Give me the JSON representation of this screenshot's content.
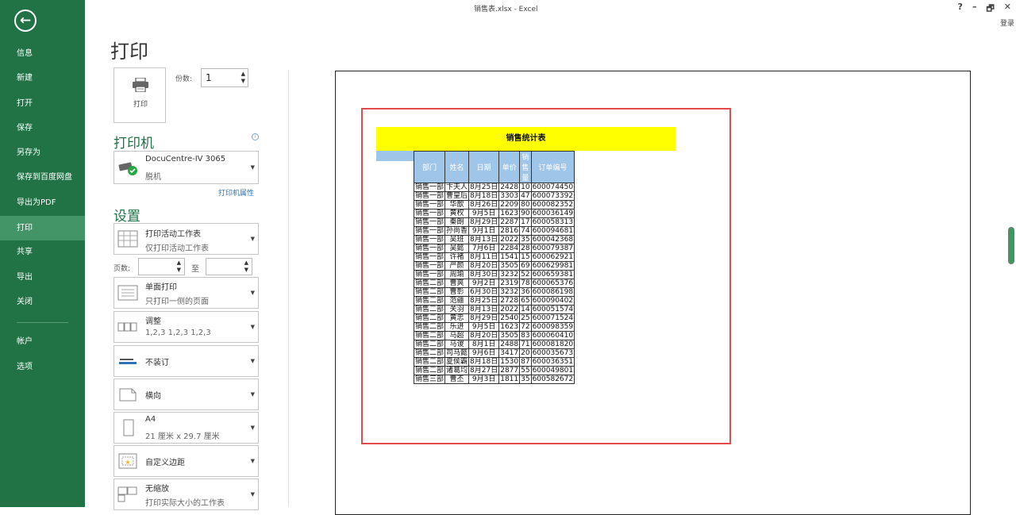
{
  "window": {
    "title": "销售表.xlsx - Excel",
    "help": "?",
    "minimize": "–",
    "restore": "🗗",
    "close": "✕",
    "login": "登录"
  },
  "nav": {
    "back": "←",
    "items": [
      "信息",
      "新建",
      "打开",
      "保存",
      "另存为",
      "保存到百度网盘",
      "导出为PDF",
      "打印",
      "共享",
      "导出",
      "关闭"
    ],
    "bottom_items": [
      "帐户",
      "选项"
    ],
    "active": "打印"
  },
  "print_panel": {
    "title": "打印",
    "print_button": "打印",
    "copies_label": "份数:",
    "copies_value": "1",
    "printer_heading": "打印机",
    "printer_name": "DocuCentre-IV 3065",
    "printer_status": "脱机",
    "printer_props": "打印机属性",
    "settings_heading": "设置",
    "pages_label": "页数:",
    "pages_to": "至",
    "settings": [
      {
        "line1": "打印活动工作表",
        "line2": "仅打印活动工作表"
      },
      {
        "line1": "单面打印",
        "line2": "只打印一侧的页面"
      },
      {
        "line1": "调整",
        "line2": "1,2,3    1,2,3    1,2,3"
      },
      {
        "line1": "不装订",
        "line2": ""
      },
      {
        "line1": "横向",
        "line2": ""
      },
      {
        "line1": "A4",
        "line2": "21 厘米 x 29.7 厘米"
      },
      {
        "line1": "自定义边距",
        "line2": ""
      },
      {
        "line1": "无缩放",
        "line2": "打印实际大小的工作表"
      }
    ]
  },
  "preview": {
    "sheet_title": "销售统计表",
    "headers": [
      "部门",
      "姓名",
      "日期",
      "单价",
      "销售量",
      "订单编号"
    ],
    "rows": [
      [
        "销售一部",
        "卞夫人",
        "8月25日",
        "2428",
        "10",
        "600074450"
      ],
      [
        "销售一部",
        "曹皇后",
        "8月18日",
        "3303",
        "47",
        "600073392"
      ],
      [
        "销售一部",
        "华歆",
        "8月26日",
        "2209",
        "80",
        "600082352"
      ],
      [
        "销售一部",
        "黄权",
        "9月5日",
        "1623",
        "90",
        "600036149"
      ],
      [
        "销售一部",
        "秦朗",
        "8月29日",
        "2287",
        "17",
        "600058313"
      ],
      [
        "销售一部",
        "孙尚香",
        "9月1日",
        "2816",
        "74",
        "600094681"
      ],
      [
        "销售一部",
        "吴班",
        "8月13日",
        "2022",
        "35",
        "600042368"
      ],
      [
        "销售一部",
        "吴懿",
        "7月6日",
        "2284",
        "28",
        "600079387"
      ],
      [
        "销售一部",
        "许褚",
        "8月11日",
        "1541",
        "15",
        "600062921"
      ],
      [
        "销售一部",
        "严颜",
        "8月20日",
        "3505",
        "69",
        "600629981"
      ],
      [
        "销售一部",
        "周瑜",
        "8月30日",
        "3232",
        "52",
        "600659381"
      ],
      [
        "销售二部",
        "曹爽",
        "9月2日",
        "2319",
        "78",
        "600065376"
      ],
      [
        "销售二部",
        "曹彰",
        "6月30日",
        "3232",
        "36",
        "600086198"
      ],
      [
        "销售二部",
        "范疆",
        "8月25日",
        "2728",
        "65",
        "600090402"
      ],
      [
        "销售二部",
        "关羽",
        "8月13日",
        "2022",
        "14",
        "600051574"
      ],
      [
        "销售二部",
        "黄忠",
        "8月29日",
        "2540",
        "25",
        "600071524"
      ],
      [
        "销售二部",
        "乐进",
        "9月5日",
        "1623",
        "72",
        "600098359"
      ],
      [
        "销售二部",
        "马超",
        "8月20日",
        "3505",
        "83",
        "600060410"
      ],
      [
        "销售二部",
        "马谡",
        "8月1日",
        "2488",
        "71",
        "600081820"
      ],
      [
        "销售二部",
        "司马懿",
        "9月6日",
        "3417",
        "20",
        "600035673"
      ],
      [
        "销售二部",
        "夏侯霸",
        "8月18日",
        "1530",
        "87",
        "600036351"
      ],
      [
        "销售二部",
        "诸葛均",
        "8月27日",
        "2877",
        "55",
        "600049801"
      ],
      [
        "销售三部",
        "曹丕",
        "9月3日",
        "1811",
        "35",
        "600582672"
      ]
    ]
  },
  "colors": {
    "brand": "#217346",
    "highlight": "#ff0000",
    "header_fill": "#9fc5e8",
    "title_fill": "#ffff00"
  }
}
